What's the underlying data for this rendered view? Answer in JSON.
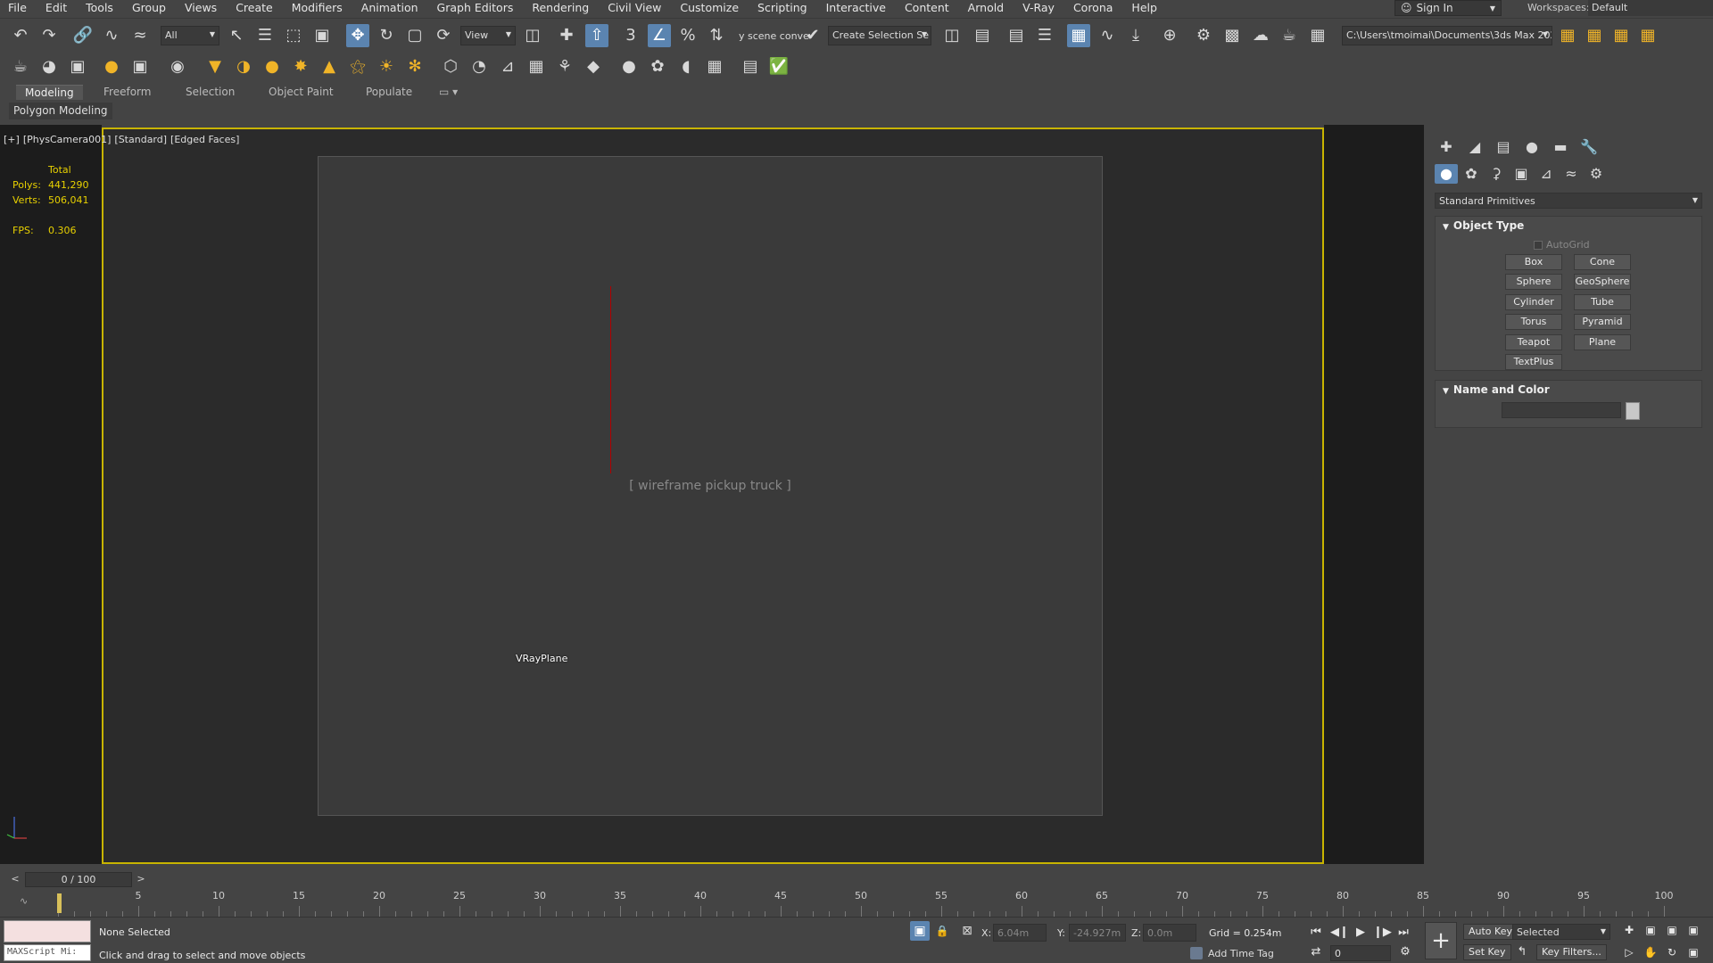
{
  "menu": [
    "File",
    "Edit",
    "Tools",
    "Group",
    "Views",
    "Create",
    "Modifiers",
    "Animation",
    "Graph Editors",
    "Rendering",
    "Civil View",
    "Customize",
    "Scripting",
    "Interactive",
    "Content",
    "Arnold",
    "V-Ray",
    "Corona",
    "Help"
  ],
  "sign_in": "Sign In",
  "workspaces_label": "Workspaces:",
  "workspace_value": "Default",
  "toolbar": {
    "filter_value": "All",
    "ref_coord_value": "View",
    "scene_converter": "y scene conve",
    "selection_set": "Create Selection Se",
    "project_path": "C:\\Users\\tmoimai\\Documents\\3ds Max 2020"
  },
  "ribbon_tabs": [
    "Modeling",
    "Freeform",
    "Selection",
    "Object Paint",
    "Populate"
  ],
  "ribbon_sub": "Polygon Modeling",
  "viewport": {
    "labels": [
      "[+]",
      "[PhysCamera001]",
      "[Standard]",
      "[Edged Faces]"
    ],
    "stats_header": "Total",
    "polys_label": "Polys:",
    "polys_value": "441,290",
    "verts_label": "Verts:",
    "verts_value": "506,041",
    "fps_label": "FPS:",
    "fps_value": "0.306",
    "object_label": "VRayPlane"
  },
  "command_panel": {
    "dropdown": "Standard Primitives",
    "object_type_title": "Object Type",
    "autogrid": "AutoGrid",
    "primitives": [
      "Box",
      "Cone",
      "Sphere",
      "GeoSphere",
      "Cylinder",
      "Tube",
      "Torus",
      "Pyramid",
      "Teapot",
      "Plane",
      "TextPlus"
    ],
    "name_color_title": "Name and Color"
  },
  "timeline": {
    "position": "0 / 100",
    "ticks": [
      "5",
      "10",
      "15",
      "20",
      "25",
      "30",
      "35",
      "40",
      "45",
      "50",
      "55",
      "60",
      "65",
      "70",
      "75",
      "80",
      "85",
      "90",
      "95",
      "100"
    ]
  },
  "status": {
    "maxscript": "MAXScript Mi:",
    "selection": "None Selected",
    "prompt": "Click and drag to select and move objects",
    "x_label": "X:",
    "x_value": "6.04m",
    "y_label": "Y:",
    "y_value": "-24.927m",
    "z_label": "Z:",
    "z_value": "0.0m",
    "grid": "Grid = 0.254m",
    "add_time_tag": "Add Time Tag",
    "frame_value": "0",
    "auto_key": "Auto Key",
    "set_key": "Set Key",
    "selected_drop": "Selected",
    "key_filters": "Key Filters..."
  },
  "colors": {
    "viewport_border": "#c8b400",
    "stats_text": "#e8d100",
    "active_tool": "#5b84b0"
  }
}
